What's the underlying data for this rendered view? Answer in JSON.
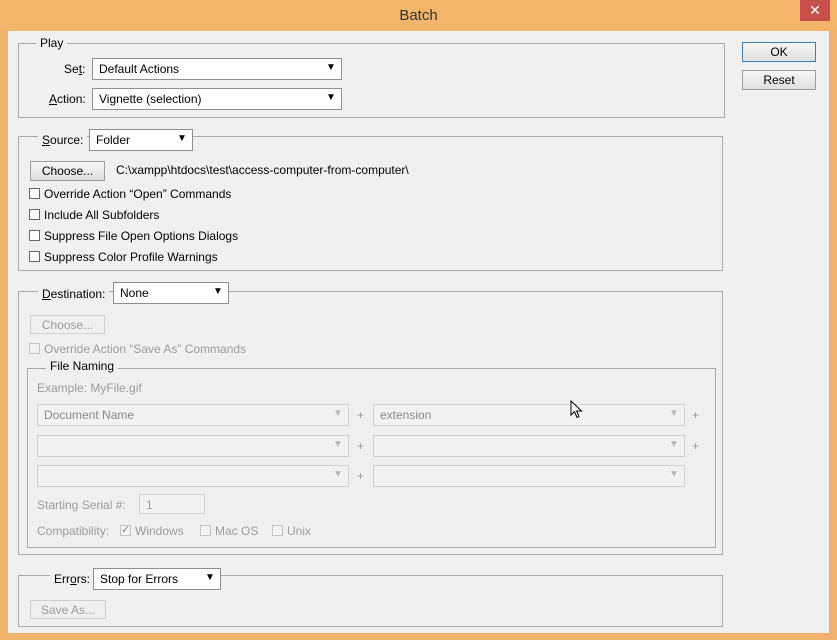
{
  "window": {
    "title": "Batch",
    "close_symbol": "✕"
  },
  "buttons": {
    "ok": "OK",
    "reset": "Reset"
  },
  "play": {
    "legend": "Play",
    "set_label": "Set:",
    "set_value": "Default Actions",
    "action_label": "Action:",
    "action_value": "Vignette (selection)"
  },
  "source": {
    "label": "Source:",
    "value": "Folder",
    "choose": "Choose...",
    "path": "C:\\xampp\\htdocs\\test\\access-computer-from-computer\\",
    "options": [
      {
        "label": "Override Action “Open” Commands",
        "checked": false
      },
      {
        "label": "Include All Subfolders",
        "checked": false
      },
      {
        "label": "Suppress File Open Options Dialogs",
        "checked": false
      },
      {
        "label": "Suppress Color Profile Warnings",
        "checked": false
      }
    ]
  },
  "destination": {
    "label": "Destination:",
    "value": "None",
    "choose": "Choose...",
    "override": "Override Action “Save As” Commands",
    "file_naming": {
      "legend": "File Naming",
      "example": "Example: MyFile.gif",
      "rows": [
        [
          "Document Name",
          "extension"
        ],
        [
          "",
          ""
        ],
        [
          "",
          ""
        ]
      ],
      "plus": "+",
      "serial_label": "Starting Serial #:",
      "serial_value": "1",
      "compat_label": "Compatibility:",
      "compat": [
        {
          "label": "Windows",
          "checked": true
        },
        {
          "label": "Mac OS",
          "checked": false
        },
        {
          "label": "Unix",
          "checked": false
        }
      ]
    }
  },
  "errors": {
    "label": "Errors:",
    "value": "Stop for Errors",
    "save_as": "Save As..."
  }
}
